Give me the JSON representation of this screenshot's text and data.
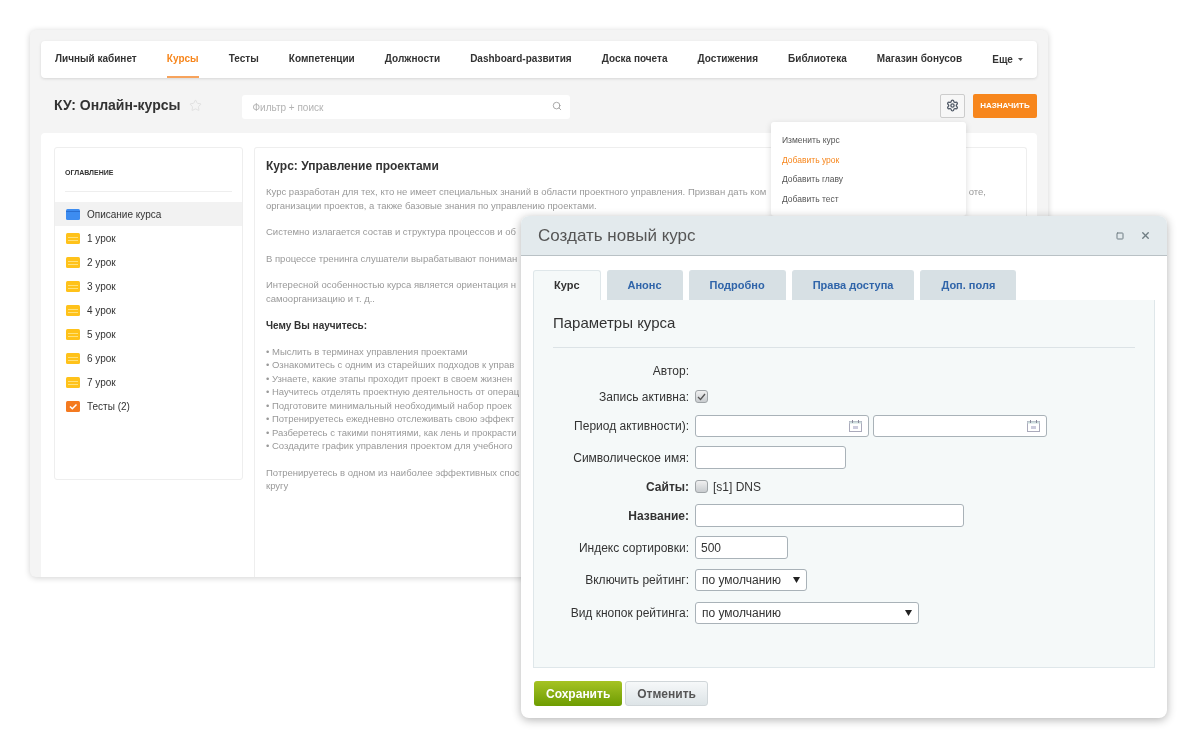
{
  "nav": {
    "items": [
      {
        "label": "Личный кабинет",
        "selected": false
      },
      {
        "label": "Курсы",
        "selected": true
      },
      {
        "label": "Тесты",
        "selected": false
      },
      {
        "label": "Компетенции",
        "selected": false
      },
      {
        "label": "Должности",
        "selected": false
      },
      {
        "label": "Dashboard-развития",
        "selected": false
      },
      {
        "label": "Доска почета",
        "selected": false
      },
      {
        "label": "Достижения",
        "selected": false
      },
      {
        "label": "Библиотека",
        "selected": false
      },
      {
        "label": "Магазин бонусов",
        "selected": false
      }
    ],
    "more": "Еще"
  },
  "header": {
    "title": "КУ: Онлайн-курсы",
    "search": {
      "placeholder": "Фильтр + поиск"
    },
    "assign_button": "НАЗНАЧИТЬ"
  },
  "menu": {
    "items": [
      {
        "label": "Изменить курс",
        "selected": false
      },
      {
        "label": "Добавить урок",
        "selected": true
      },
      {
        "label": "Добавить главу",
        "selected": false
      },
      {
        "label": "Добавить тест",
        "selected": false
      }
    ]
  },
  "toc": {
    "title": "ОГЛАВЛЕНИЕ",
    "items": [
      {
        "label": "Описание курса",
        "kind": "description",
        "selected": true
      },
      {
        "label": "1 урок",
        "kind": "lesson",
        "selected": false
      },
      {
        "label": "2 урок",
        "kind": "lesson",
        "selected": false
      },
      {
        "label": "3 урок",
        "kind": "lesson",
        "selected": false
      },
      {
        "label": "4 урок",
        "kind": "lesson",
        "selected": false
      },
      {
        "label": "5 урок",
        "kind": "lesson",
        "selected": false
      },
      {
        "label": "6 урок",
        "kind": "lesson",
        "selected": false
      },
      {
        "label": "7 урок",
        "kind": "lesson",
        "selected": false
      },
      {
        "label": "Тесты (2)",
        "kind": "tests",
        "selected": false
      }
    ]
  },
  "content": {
    "title": "Курс: Управление проектами",
    "blocks": [
      {
        "kind": "text",
        "lines": [
          {
            "text": "Курс разработан для тех, кто не имеет специальных знаний в области проектного управления. Призван дать ком",
            "tail": "оте,"
          },
          {
            "text": "организации проектов, а также базовые знания по управлению проектами."
          }
        ]
      },
      {
        "kind": "text",
        "lines": [
          {
            "text": "Системно излагается состав и структура процессов и об"
          }
        ]
      },
      {
        "kind": "text",
        "lines": [
          {
            "text": "В процессе тренинга слушатели вырабатывают пониман"
          }
        ]
      },
      {
        "kind": "text",
        "lines": [
          {
            "text": "Интересной особенностью курса является ориентация н"
          },
          {
            "text": "самоорганизацию и т. д.."
          }
        ]
      },
      {
        "kind": "heading",
        "lines": [
          {
            "text": "Чему Вы научитесь:"
          }
        ]
      },
      {
        "kind": "bullets",
        "lines": [
          {
            "text": "• Мыслить в терминах управления проектами"
          },
          {
            "text": "• Ознакомитесь с одним из старейших подходов к управ"
          },
          {
            "text": "• Узнаете, какие этапы проходит проект в своем жизнен"
          },
          {
            "text": "• Научитесь отделять проектную деятельность от операц"
          },
          {
            "text": "• Подготовите минимальный необходимый набор проек"
          },
          {
            "text": "• Потренируетесь ежедневно отслеживать свою эффект"
          },
          {
            "text": "• Разберетесь с такими понятиями, как лень и прокрасти"
          },
          {
            "text": "• Создадите график управления проектом для учебного"
          }
        ]
      },
      {
        "kind": "text",
        "lines": [
          {
            "text": "Потренируетесь в одном из наиболее эффективных спос"
          },
          {
            "text": "кругу"
          }
        ]
      }
    ]
  },
  "dialog": {
    "title": "Создать новый курс",
    "tabs": [
      {
        "label": "Курс",
        "selected": true
      },
      {
        "label": "Анонс",
        "selected": false
      },
      {
        "label": "Подробно",
        "selected": false
      },
      {
        "label": "Права доступа",
        "selected": false
      },
      {
        "label": "Доп. поля",
        "selected": false
      }
    ],
    "section_title": "Параметры курса",
    "fields": [
      {
        "kind": "static",
        "label": "Автор:",
        "required": false
      },
      {
        "kind": "checkbox",
        "label": "Запись активна:",
        "required": false,
        "checked": true
      },
      {
        "kind": "daterange",
        "label": "Период активности):",
        "required": false
      },
      {
        "kind": "input",
        "label": "Символическое имя:",
        "required": false
      },
      {
        "kind": "checkbox",
        "label": "Сайты:",
        "required": true,
        "checked": false,
        "option": "[s1] DNS"
      },
      {
        "kind": "input",
        "label": "Название:",
        "required": true
      },
      {
        "kind": "input",
        "label": "Индекс сортировки:",
        "required": false,
        "value": "500"
      },
      {
        "kind": "select",
        "label": "Включить рейтинг:",
        "required": false,
        "value": "по умолчанию"
      },
      {
        "kind": "select",
        "label": "Вид кнопок рейтинга:",
        "required": false,
        "value": "по умолчанию"
      }
    ],
    "buttons": {
      "save": "Сохранить",
      "cancel": "Отменить"
    }
  }
}
